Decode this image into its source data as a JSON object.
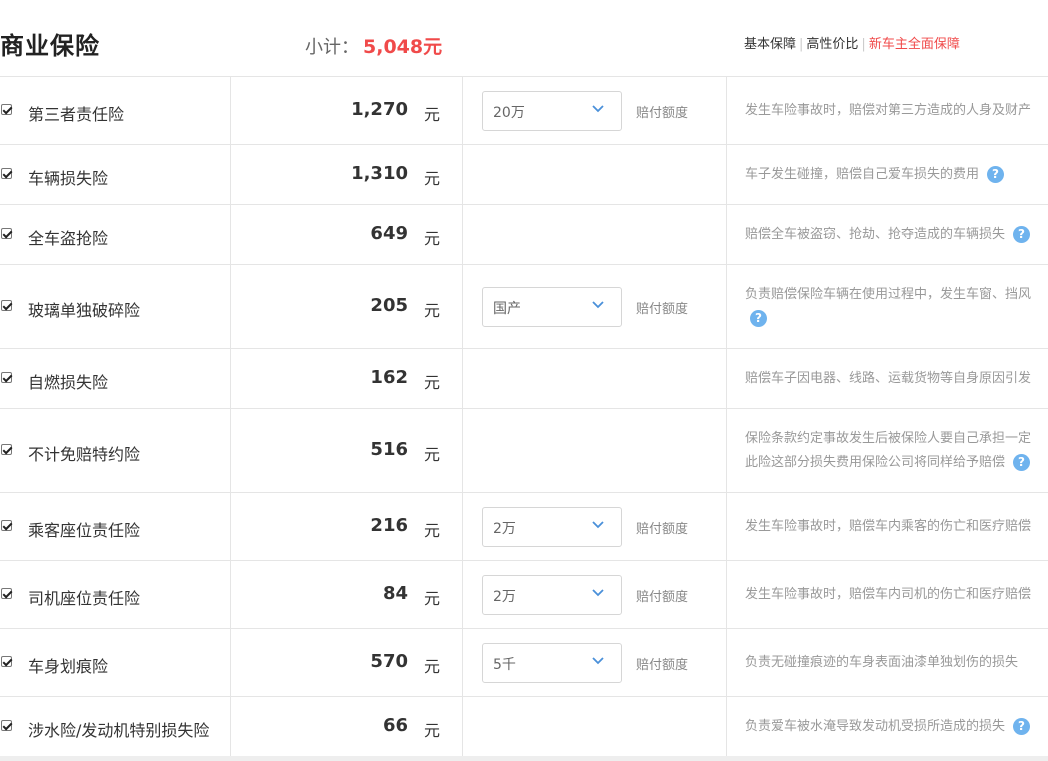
{
  "header": {
    "title": "商业保险",
    "subtotal_label": "小计：",
    "subtotal_amount": "5,048元",
    "plans": [
      {
        "label": "基本保障",
        "active": false
      },
      {
        "label": "高性价比",
        "active": false
      },
      {
        "label": "新车主全面保障",
        "active": true
      }
    ]
  },
  "unit": "元",
  "coverage_label": "赔付额度",
  "rows": [
    {
      "name": "第三者责任险",
      "price": "1,270",
      "checked": true,
      "select": "20万",
      "desc": [
        "发生车险事故时，赔偿对第三方造成的人身及财产"
      ],
      "help": false
    },
    {
      "name": "车辆损失险",
      "price": "1,310",
      "checked": true,
      "select": null,
      "desc": [
        "车子发生碰撞，赔偿自己爱车损失的费用"
      ],
      "help": true
    },
    {
      "name": "全车盗抢险",
      "price": "649",
      "checked": true,
      "select": null,
      "desc": [
        "赔偿全车被盗窃、抢劫、抢夺造成的车辆损失"
      ],
      "help": true
    },
    {
      "name": "玻璃单独破碎险",
      "price": "205",
      "checked": true,
      "select": "国产",
      "desc": [
        "负责赔偿保险车辆在使用过程中，发生车窗、挡风"
      ],
      "help": true
    },
    {
      "name": "自燃损失险",
      "price": "162",
      "checked": true,
      "select": null,
      "desc": [
        "赔偿车子因电器、线路、运载货物等自身原因引发"
      ],
      "help": false
    },
    {
      "name": "不计免赔特约险",
      "price": "516",
      "checked": true,
      "select": null,
      "desc": [
        "保险条款约定事故发生后被保险人要自己承担一定",
        "此险这部分损失费用保险公司将同样给予赔偿"
      ],
      "help": true
    },
    {
      "name": "乘客座位责任险",
      "price": "216",
      "checked": true,
      "select": "2万",
      "desc": [
        "发生车险事故时，赔偿车内乘客的伤亡和医疗赔偿"
      ],
      "help": false
    },
    {
      "name": "司机座位责任险",
      "price": "84",
      "checked": true,
      "select": "2万",
      "desc": [
        "发生车险事故时，赔偿车内司机的伤亡和医疗赔偿"
      ],
      "help": false
    },
    {
      "name": "车身划痕险",
      "price": "570",
      "checked": true,
      "select": "5千",
      "desc": [
        "负责无碰撞痕迹的车身表面油漆单独划伤的损失"
      ],
      "help": false
    },
    {
      "name": "涉水险/发动机特别损失险",
      "price": "66",
      "checked": true,
      "select": null,
      "desc": [
        "负责爱车被水淹导致发动机受损所造成的损失"
      ],
      "help": true
    }
  ],
  "help_icon_glyph": "?",
  "colors": {
    "accent_red": "#f04a4a",
    "help_blue": "#6fb3ee",
    "border": "#e5e5e5"
  }
}
